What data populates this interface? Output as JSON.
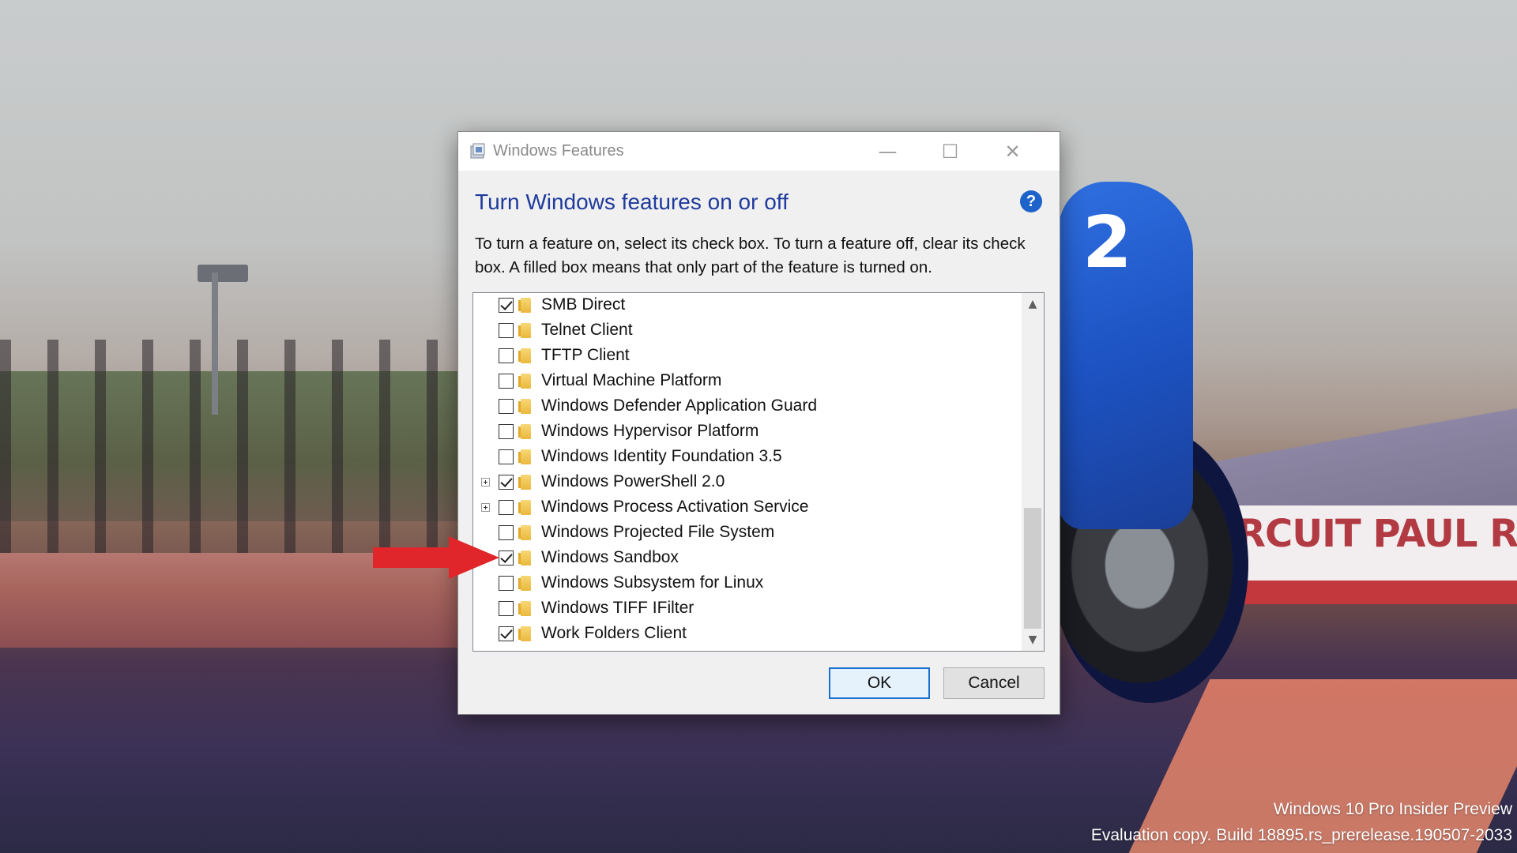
{
  "window": {
    "title": "Windows Features",
    "heading": "Turn Windows features on or off",
    "help": "?",
    "description": "To turn a feature on, select its check box. To turn a feature off, clear its check box. A filled box means that only part of the feature is turned on.",
    "caption": {
      "minimize": "—",
      "maximize": "☐",
      "close": "✕"
    }
  },
  "features": [
    {
      "label": "SMB Direct",
      "checked": true,
      "expandable": false
    },
    {
      "label": "Telnet Client",
      "checked": false,
      "expandable": false
    },
    {
      "label": "TFTP Client",
      "checked": false,
      "expandable": false
    },
    {
      "label": "Virtual Machine Platform",
      "checked": false,
      "expandable": false
    },
    {
      "label": "Windows Defender Application Guard",
      "checked": false,
      "expandable": false
    },
    {
      "label": "Windows Hypervisor Platform",
      "checked": false,
      "expandable": false
    },
    {
      "label": "Windows Identity Foundation 3.5",
      "checked": false,
      "expandable": false
    },
    {
      "label": "Windows PowerShell 2.0",
      "checked": true,
      "expandable": true
    },
    {
      "label": "Windows Process Activation Service",
      "checked": false,
      "expandable": true
    },
    {
      "label": "Windows Projected File System",
      "checked": false,
      "expandable": false
    },
    {
      "label": "Windows Sandbox",
      "checked": true,
      "expandable": false
    },
    {
      "label": "Windows Subsystem for Linux",
      "checked": false,
      "expandable": false
    },
    {
      "label": "Windows TIFF IFilter",
      "checked": false,
      "expandable": false
    },
    {
      "label": "Work Folders Client",
      "checked": true,
      "expandable": false
    }
  ],
  "scrollbar": {
    "up": "▲",
    "down": "▼",
    "position": 0.9
  },
  "buttons": {
    "ok": "OK",
    "cancel": "Cancel"
  },
  "desktop": {
    "banner_text": "RCUIT PAUL RI",
    "bike_number": "2",
    "watermark_line1": "Windows 10 Pro Insider Preview",
    "watermark_line2": "Evaluation copy. Build 18895.rs_prerelease.190507-2033"
  },
  "colors": {
    "heading": "#1e3a9c",
    "accent": "#1a6fd0",
    "arrow": "#e0262b"
  },
  "annotation": {
    "arrow_target": "Windows Sandbox"
  }
}
